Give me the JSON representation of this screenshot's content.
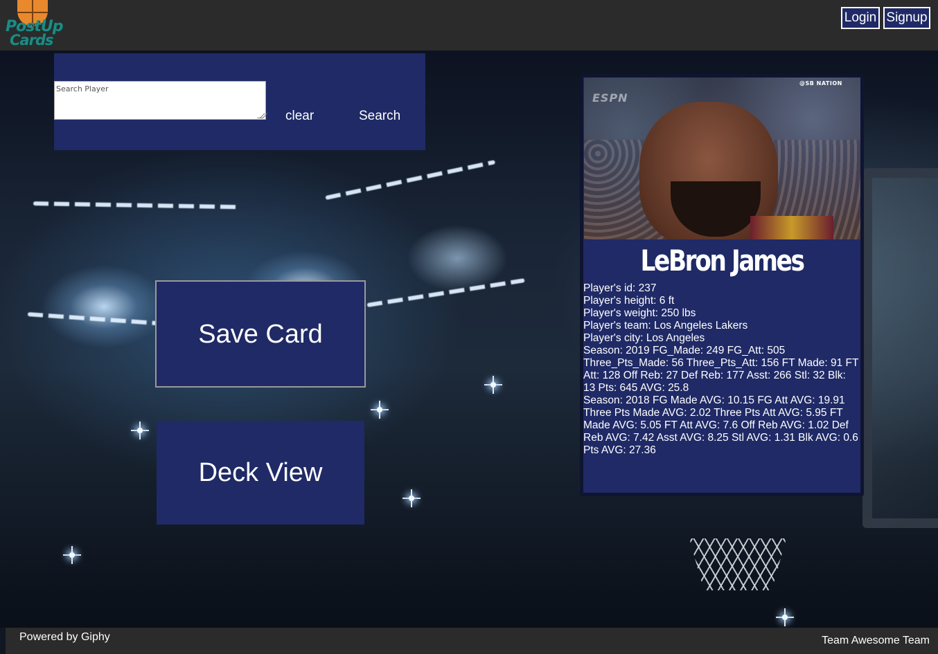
{
  "header": {
    "logo_line1": "PostUp",
    "logo_line2": "Cards",
    "login_label": "Login",
    "signup_label": "Signup"
  },
  "search": {
    "placeholder": "Search Player",
    "value": "",
    "clear_label": "clear",
    "search_label": "Search"
  },
  "actions": {
    "save_label": "Save Card",
    "deck_label": "Deck View"
  },
  "card": {
    "image_watermarks": [
      "ESPN",
      "@SB NATION"
    ],
    "name": "LeBron James",
    "stats": [
      "Player's id: 237",
      "Player's height: 6 ft",
      "Player's weight: 250 lbs",
      "Player's team: Los Angeles Lakers",
      "Player's city: Los Angeles",
      "Season: 2019 FG_Made: 249 FG_Att: 505 Three_Pts_Made: 56 Three_Pts_Att: 156 FT Made: 91 FT Att: 128 Off Reb: 27 Def Reb: 177 Asst: 266 Stl: 32 Blk: 13 Pts: 645 AVG: 25.8",
      "Season: 2018 FG Made AVG: 10.15 FG Att AVG: 19.91 Three Pts Made AVG: 2.02 Three Pts Att AVG: 5.95 FT Made AVG: 5.05 FT Att AVG: 7.6 Off Reb AVG: 1.02 Def Reb AVG: 7.42 Asst AVG: 8.25 Stl AVG: 1.31 Blk AVG: 0.6 Pts AVG: 27.36"
    ]
  },
  "footer": {
    "left_text": "Powered by Giphy",
    "right_text": "Team Awesome Team"
  },
  "colors": {
    "panel_navy": "#1f2a66",
    "bar_gray": "#2b2b2b",
    "logo_teal": "#1f8a84",
    "logo_orange": "#e8892c"
  }
}
